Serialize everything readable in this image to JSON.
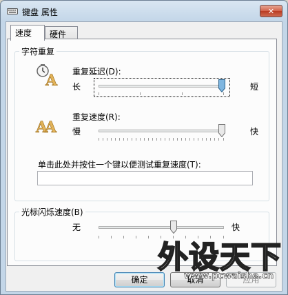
{
  "window": {
    "title": "键盘 属性",
    "close_symbol": "✕"
  },
  "tabs": [
    {
      "label": "速度",
      "active": true
    },
    {
      "label": "硬件",
      "active": false
    }
  ],
  "char_repeat": {
    "legend": "字符重复",
    "delay": {
      "label": "重复延迟(D):",
      "min_label": "长",
      "max_label": "短",
      "value_fraction": 1.0
    },
    "rate": {
      "label": "重复速度(R):",
      "min_label": "慢",
      "max_label": "快",
      "value_fraction": 1.0
    },
    "test": {
      "label": "单击此处并按住一个键以便测试重复速度(T):",
      "value": ""
    }
  },
  "cursor_blink": {
    "legend": "光标闪烁速度(B)",
    "min_label": "无",
    "max_label": "快",
    "value_fraction": 0.6
  },
  "buttons": {
    "ok": "确定",
    "cancel": "取消",
    "apply": "应用"
  },
  "watermark": {
    "title": "外设天下",
    "url": "www.pcwaishe.cn"
  },
  "colors": {
    "close_button": "#c9452b",
    "slider_thumb": "#7fb6e0",
    "window_frame": "#c3d6e8"
  }
}
